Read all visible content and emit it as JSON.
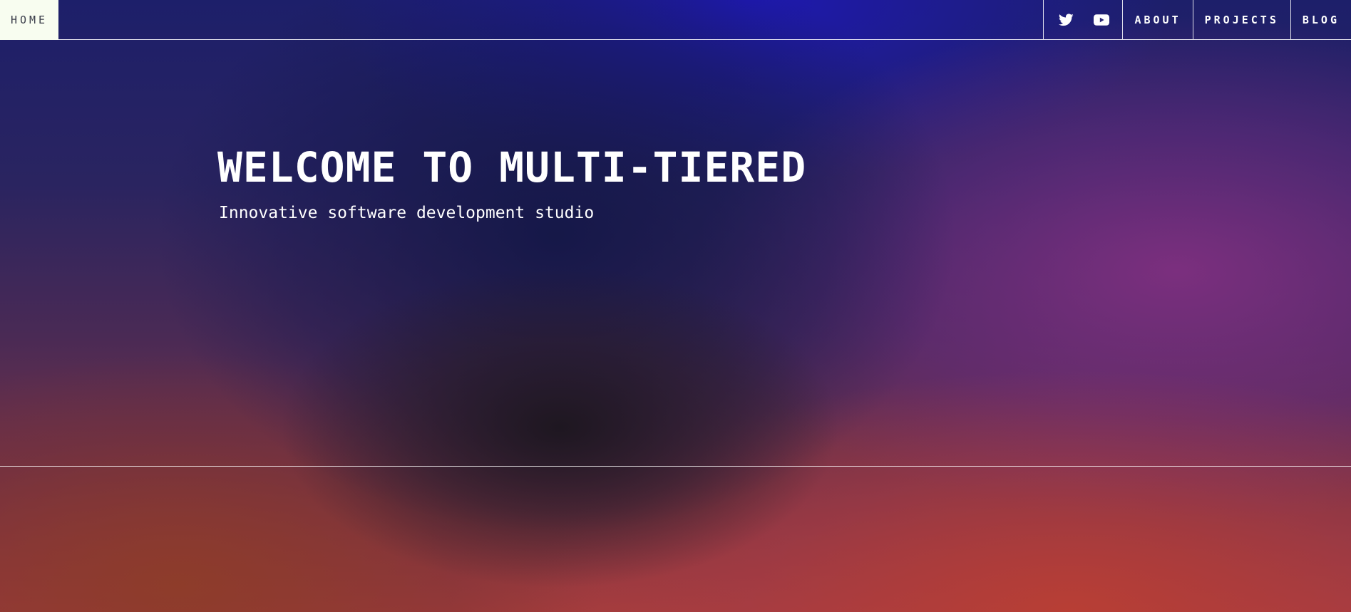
{
  "nav": {
    "home_label": "HOME",
    "social": [
      {
        "icon": "twitter-icon"
      },
      {
        "icon": "youtube-icon"
      }
    ],
    "links": [
      {
        "label": "ABOUT"
      },
      {
        "label": "PROJECTS"
      },
      {
        "label": "BLOG"
      }
    ]
  },
  "hero": {
    "title": "WELCOME TO MULTI-TIERED",
    "subtitle": "Innovative software development studio"
  },
  "colors": {
    "home_bg": "#f8fdf0",
    "text": "#ffffff",
    "gradient_top": "#1d1f6a",
    "gradient_bottom": "#a43c3c"
  }
}
